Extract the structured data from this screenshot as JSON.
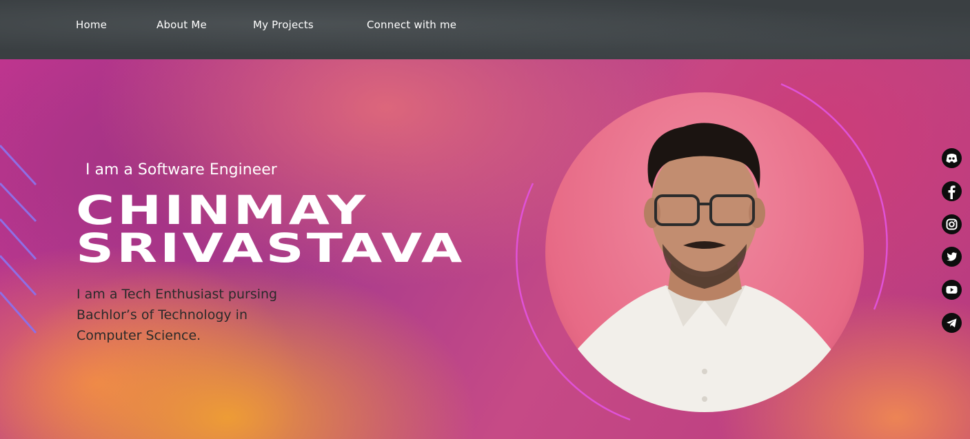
{
  "nav": {
    "items": [
      {
        "label": "Home"
      },
      {
        "label": "About Me"
      },
      {
        "label": "My Projects"
      },
      {
        "label": "Connect with me"
      }
    ]
  },
  "hero": {
    "tagline": "I am a Software Engineer",
    "name_line1": "CHINMAY",
    "name_line2": "SRIVASTAVA",
    "description": "I am a Tech Enthusiast pursing Bachlor’s of Technology in Computer Science."
  },
  "social": [
    "discord-icon",
    "facebook-icon",
    "instagram-icon",
    "twitter-icon",
    "youtube-icon",
    "telegram-icon"
  ],
  "colors": {
    "nav_bg": "#3a3f42",
    "accent_arc": "#e052d8",
    "stripe": "#8e6fe6",
    "icon_bg": "#0d0d0d"
  }
}
